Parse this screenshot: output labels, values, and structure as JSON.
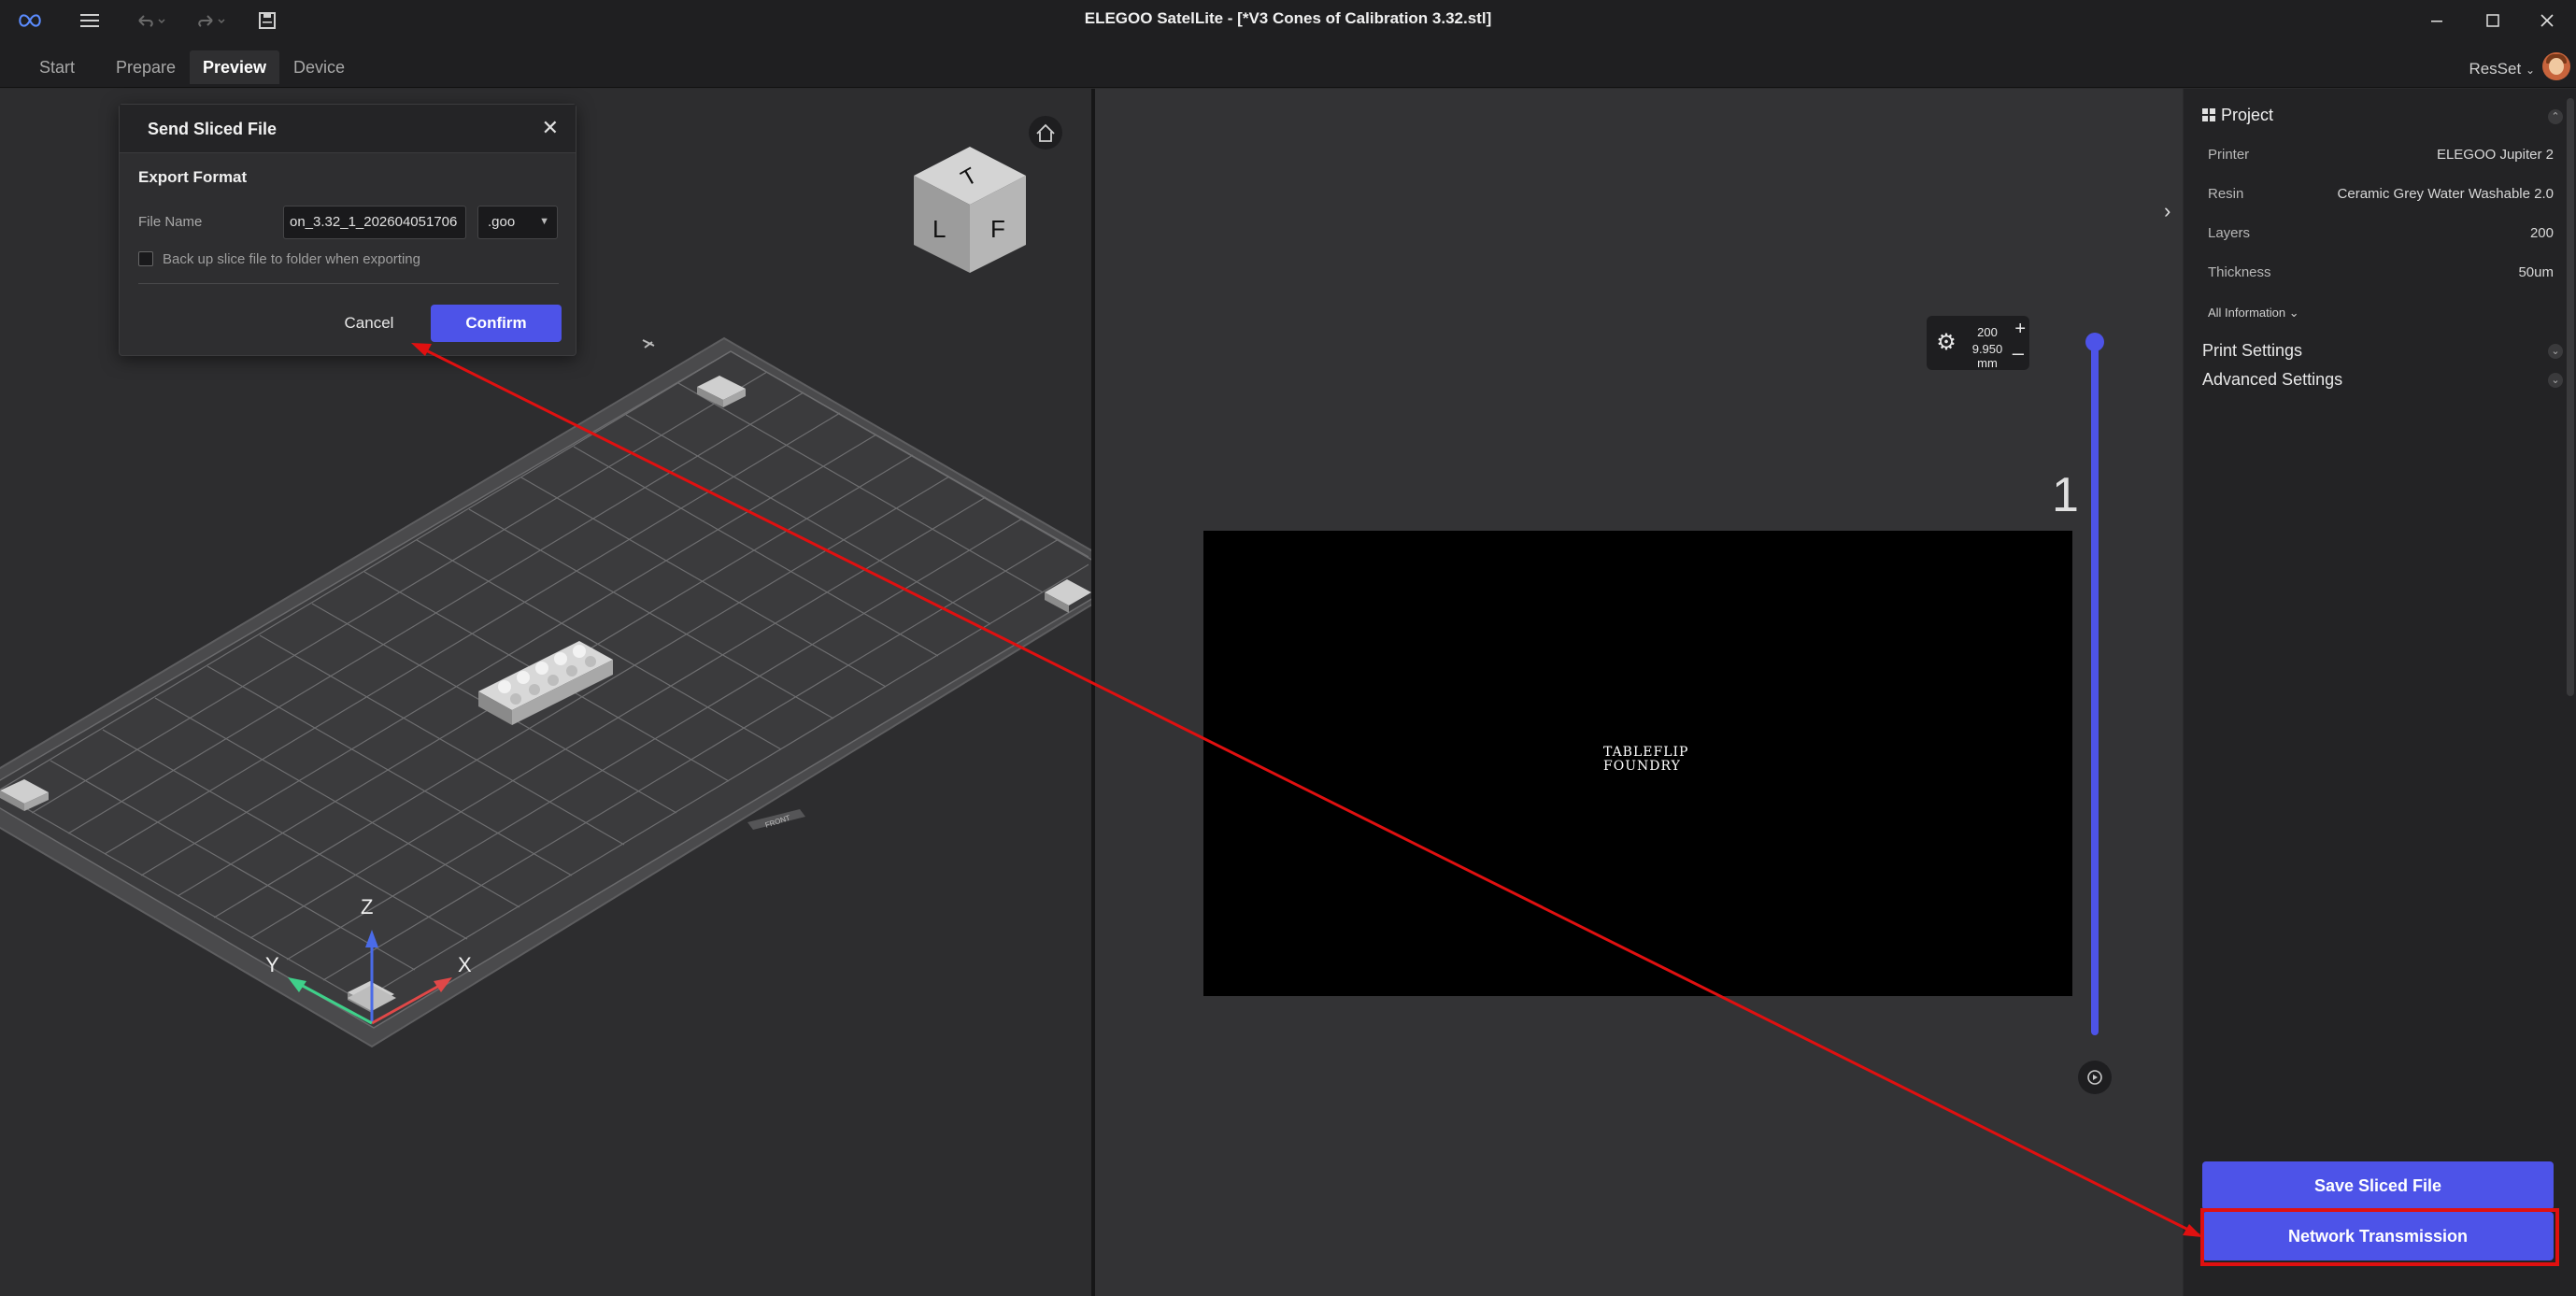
{
  "window": {
    "title": "ELEGOO SatelLite - [*V3 Cones of Calibration 3.32.stl]"
  },
  "tabs": [
    {
      "label": "Start"
    },
    {
      "label": "Prepare"
    },
    {
      "label": "Preview"
    },
    {
      "label": "Device"
    }
  ],
  "active_tab": "Preview",
  "user": {
    "name": "ResSet"
  },
  "viewport": {
    "cube_faces": {
      "top": "T",
      "left": "L",
      "front": "F"
    },
    "axes": {
      "x": "X",
      "y": "Y",
      "z": "Z"
    },
    "plate_label": "FRONT",
    "axis_colors": {
      "x": "#e04848",
      "y": "#3fd08a",
      "z": "#4a6be8"
    }
  },
  "layer_preview": {
    "layer_count": "200",
    "height": "9.950 mm",
    "current_layer": "1",
    "logo_line1": "TABLEFLIP",
    "logo_line2": "FOUNDRY"
  },
  "project": {
    "heading": "Project",
    "rows": [
      {
        "key": "Printer",
        "value": "ELEGOO Jupiter 2"
      },
      {
        "key": "Resin",
        "value": "Ceramic Grey Water Washable 2.0"
      },
      {
        "key": "Layers",
        "value": "200"
      },
      {
        "key": "Thickness",
        "value": "50um"
      }
    ],
    "all_info": "All Information",
    "print_settings": "Print Settings",
    "advanced_settings": "Advanced Settings",
    "save_button": "Save Sliced File",
    "network_button": "Network Transmission"
  },
  "dialog": {
    "title": "Send Sliced File",
    "section": "Export Format",
    "file_name_label": "File Name",
    "file_name_value": "on_3.32_1_202604051706",
    "format": ".goo",
    "backup_label": "Back up slice file to folder when exporting",
    "cancel": "Cancel",
    "confirm": "Confirm"
  },
  "colors": {
    "accent": "#4d53e8",
    "annotation": "#e01010"
  }
}
